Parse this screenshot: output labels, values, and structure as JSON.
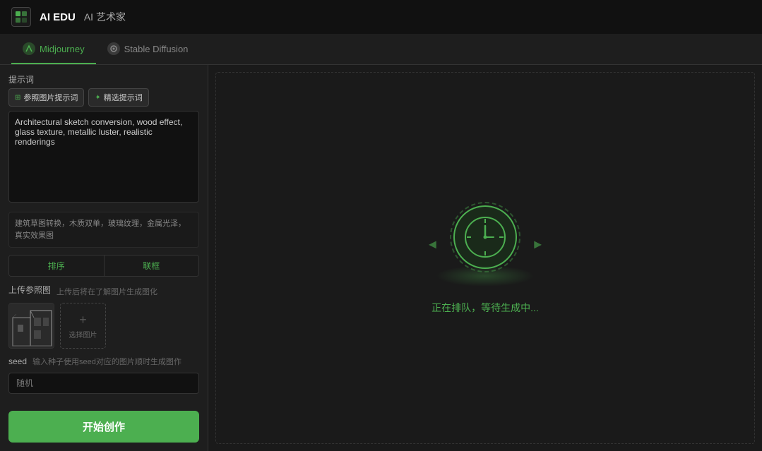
{
  "app": {
    "logo_text": "AI EDU",
    "subtitle": "AI 艺术家"
  },
  "tabs": [
    {
      "id": "midjourney",
      "label": "Midjourney",
      "active": true,
      "icon": "mj"
    },
    {
      "id": "stable-diffusion",
      "label": "Stable Diffusion",
      "active": false,
      "icon": "sd"
    }
  ],
  "left_panel": {
    "prompt_section": {
      "label": "提示词",
      "btn_sample_image": "参照图片提示词",
      "btn_sample_select": "精选提示词",
      "textarea_value": "Architectural sketch conversion, wood effect, glass texture, metallic luster, realistic renderings",
      "chinese_text": "建筑草图转换，木质双单，玻璃纹理，金属光泽，真实效果图",
      "btn_sort": "排序",
      "btn_join": "联框"
    },
    "upload_section": {
      "label": "上传参照图",
      "hint": "上传后将在了解图片生成图化",
      "select_text": "选择图片"
    },
    "seed_section": {
      "label": "seed",
      "hint": "输入种子使用seed对应的图片顺时生成图作",
      "placeholder": "随机"
    },
    "create_btn": "开始创作"
  },
  "right_panel": {
    "waiting_text": "正在排队，等待生成中..."
  }
}
